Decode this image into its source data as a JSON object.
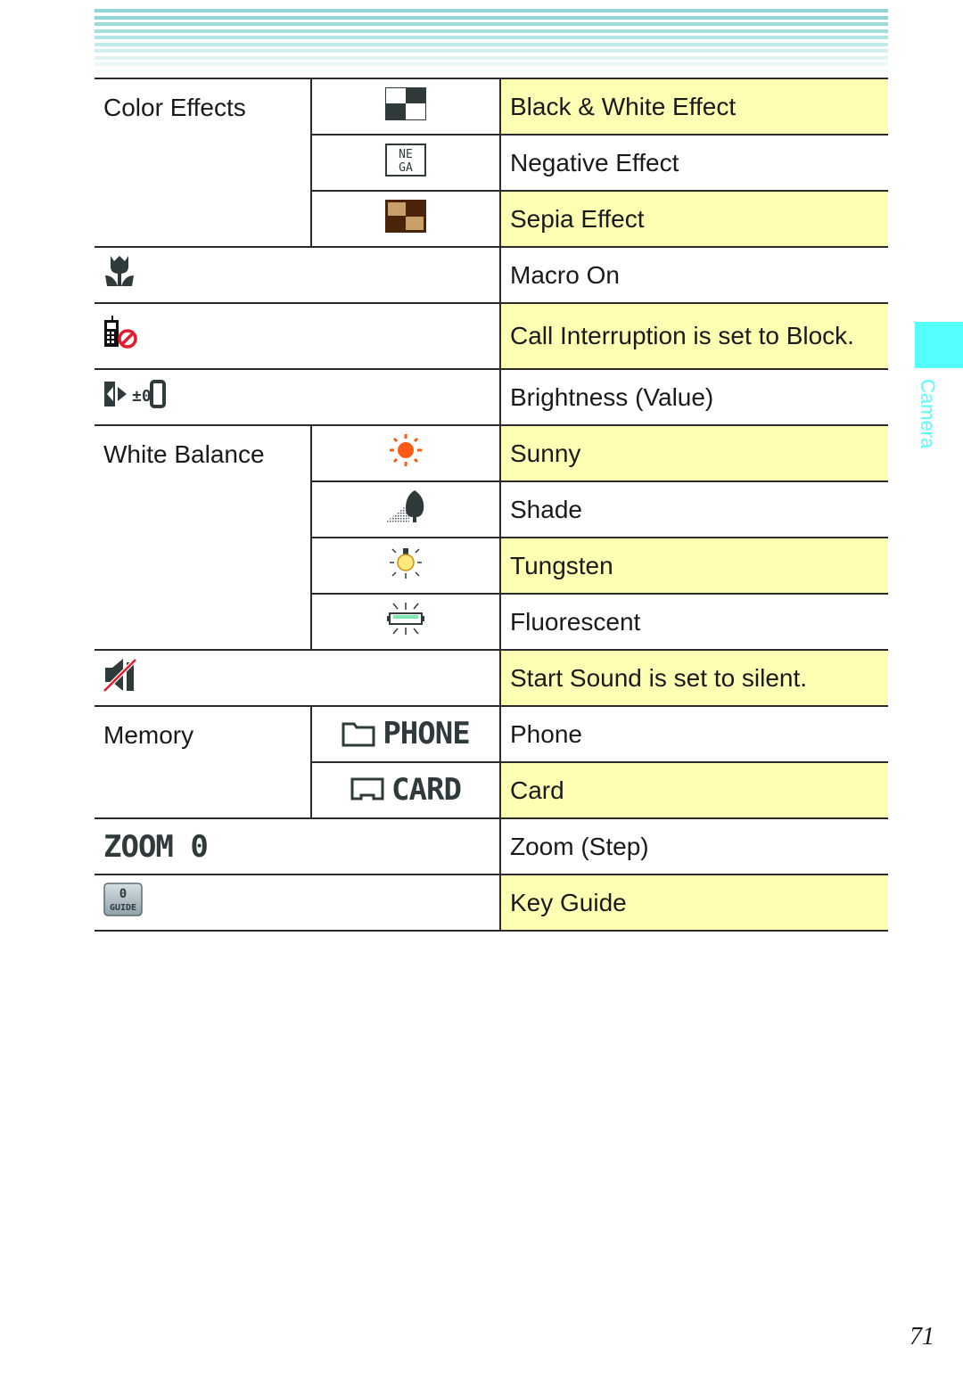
{
  "header": {
    "stripe_color": "#7fd4d4"
  },
  "side_tab": {
    "label": "Camera",
    "color": "#55ffff"
  },
  "page_number": "71",
  "highlight_color": "#ffffb4",
  "rows": [
    {
      "label": "Color Effects",
      "icon": "black-white-checker-icon",
      "desc": "Black & White Effect",
      "highlight": true
    },
    {
      "icon": "nega-icon",
      "icon_text": "NE GA",
      "desc": "Negative Effect",
      "highlight": false
    },
    {
      "icon": "sepia-checker-icon",
      "desc": "Sepia Effect",
      "highlight": true
    },
    {
      "icon": "macro-tulip-icon",
      "desc": "Macro On",
      "highlight": false
    },
    {
      "icon": "call-block-icon",
      "desc": "Call Interruption is set to Block.",
      "highlight": true
    },
    {
      "icon": "brightness-icon",
      "icon_text": "±0",
      "desc": "Brightness (Value)",
      "highlight": false
    },
    {
      "label": "White Balance",
      "icon": "sunny-icon",
      "desc": "Sunny",
      "highlight": true
    },
    {
      "icon": "shade-icon",
      "desc": "Shade",
      "highlight": false
    },
    {
      "icon": "tungsten-bulb-icon",
      "desc": "Tungsten",
      "highlight": true
    },
    {
      "icon": "fluorescent-icon",
      "desc": "Fluorescent",
      "highlight": false
    },
    {
      "icon": "sound-muted-icon",
      "desc": "Start Sound is set to silent.",
      "highlight": true
    },
    {
      "label": "Memory",
      "icon": "folder-phone-icon",
      "icon_text": "PHONE",
      "desc": "Phone",
      "highlight": false
    },
    {
      "icon": "card-icon",
      "icon_text": "CARD",
      "desc": "Card",
      "highlight": true
    },
    {
      "icon": "zoom-icon",
      "icon_text": "ZOOM 0",
      "desc": "Zoom (Step)",
      "highlight": false
    },
    {
      "icon": "key-guide-icon",
      "icon_text": "0 GUIDE",
      "desc": "Key Guide",
      "highlight": true
    }
  ]
}
